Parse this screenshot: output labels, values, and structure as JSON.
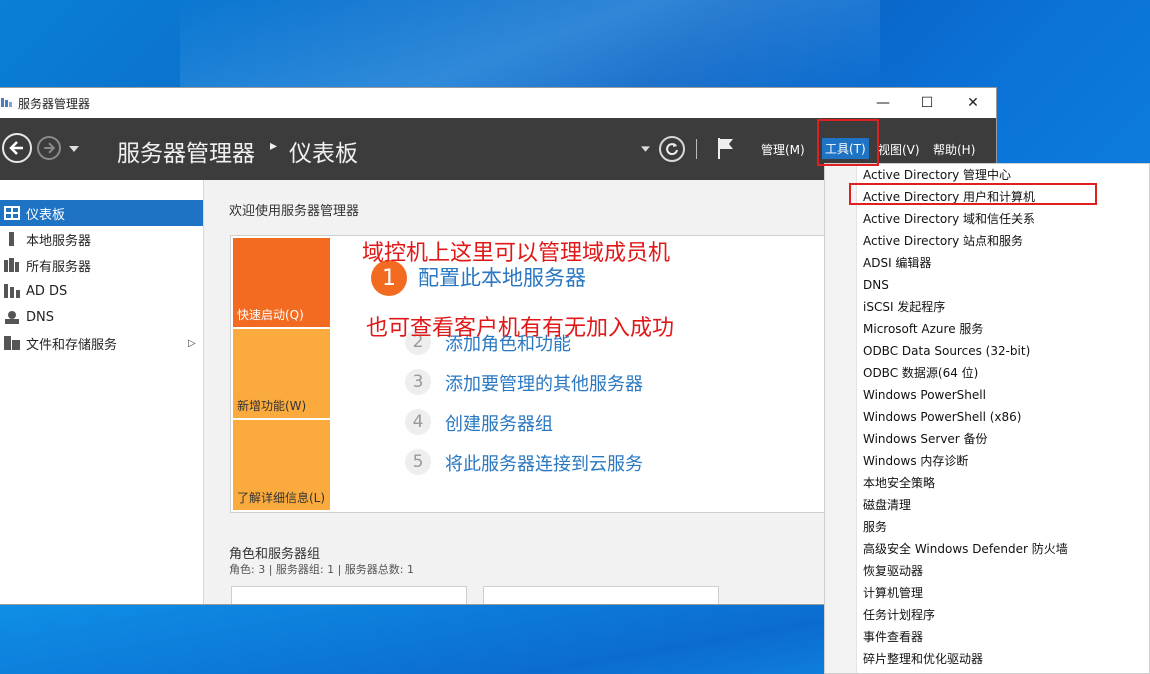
{
  "window": {
    "title": "服务器管理器",
    "controls": {
      "minimize": "—",
      "maximize": "☐",
      "close": "✕"
    }
  },
  "header": {
    "breadcrumb_root": "服务器管理器",
    "breadcrumb_sep": "▸",
    "breadcrumb_page": "仪表板",
    "menus": {
      "manage": "管理(M)",
      "tools": "工具(T)",
      "view": "视图(V)",
      "help": "帮助(H)"
    }
  },
  "sidebar": {
    "items": [
      {
        "label": "仪表板",
        "icon": "dashboard-icon",
        "active": true
      },
      {
        "label": "本地服务器",
        "icon": "server-icon"
      },
      {
        "label": "所有服务器",
        "icon": "servers-icon"
      },
      {
        "label": "AD DS",
        "icon": "ad-ds-icon"
      },
      {
        "label": "DNS",
        "icon": "dns-icon"
      },
      {
        "label": "文件和存储服务",
        "icon": "storage-icon",
        "has_arrow": true
      }
    ],
    "arrow": "▷"
  },
  "welcome": {
    "title": "欢迎使用服务器管理器",
    "tiles": [
      "快速启动(Q)",
      "新增功能(W)",
      "了解详细信息(L)"
    ],
    "steps": [
      {
        "num": "1",
        "label": "配置此本地服务器"
      },
      {
        "num": "2",
        "label": "添加角色和功能"
      },
      {
        "num": "3",
        "label": "添加要管理的其他服务器"
      },
      {
        "num": "4",
        "label": "创建服务器组"
      },
      {
        "num": "5",
        "label": "将此服务器连接到云服务"
      }
    ]
  },
  "roles": {
    "title": "角色和服务器组",
    "summary": "角色: 3 | 服务器组: 1 | 服务器总数: 1"
  },
  "tools_menu": {
    "items": [
      "Active Directory 管理中心",
      "Active Directory 用户和计算机",
      "Active Directory 域和信任关系",
      "Active Directory 站点和服务",
      "ADSI 编辑器",
      "DNS",
      "iSCSI 发起程序",
      "Microsoft Azure 服务",
      "ODBC Data Sources (32-bit)",
      "ODBC 数据源(64 位)",
      "Windows PowerShell",
      "Windows PowerShell (x86)",
      "Windows Server 备份",
      "Windows 内存诊断",
      "本地安全策略",
      "磁盘清理",
      "服务",
      "高级安全 Windows Defender 防火墙",
      "恢复驱动器",
      "计算机管理",
      "任务计划程序",
      "事件查看器",
      "碎片整理和优化驱动器"
    ]
  },
  "annotations": {
    "line1": "域控机上这里可以管理域成员机",
    "line2": "也可查看客户机有有无加入成功"
  },
  "colors": {
    "accent": "#1e73c5",
    "tile_dark": "#f26b21",
    "tile_light": "#fbab3d",
    "annotation": "#e01818",
    "header": "#3c3c3c"
  }
}
